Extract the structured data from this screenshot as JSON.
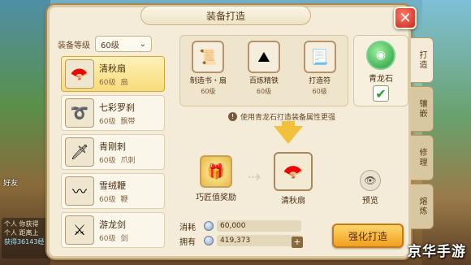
{
  "window": {
    "title": "装备打造",
    "close_label": "✕"
  },
  "filter": {
    "label": "装备等级",
    "selected": "60级"
  },
  "equipment_list": [
    {
      "name": "清秋扇",
      "level": "60级",
      "type": "扇",
      "icon": "fan-icon",
      "selected": true
    },
    {
      "name": "七彩罗刹",
      "level": "60级",
      "type": "飘带",
      "icon": "ribbon-icon",
      "selected": false
    },
    {
      "name": "青刚刺",
      "level": "60级",
      "type": "爪刺",
      "icon": "claw-icon",
      "selected": false
    },
    {
      "name": "雪绒鞭",
      "level": "60级",
      "type": "鞭",
      "icon": "whip-icon",
      "selected": false
    },
    {
      "name": "游龙剑",
      "level": "60级",
      "type": "剑",
      "icon": "sword-icon",
      "selected": false
    }
  ],
  "materials": [
    {
      "name": "制造书・扇",
      "level": "60级",
      "icon": "blueprint-icon"
    },
    {
      "name": "百炼精铁",
      "level": "60级",
      "icon": "iron-ore-icon"
    },
    {
      "name": "打造符",
      "level": "60级",
      "icon": "talisman-icon"
    }
  ],
  "dragon_stone": {
    "name": "青龙石",
    "checked": true,
    "check_mark": "✔",
    "icon": "dragon-stone-icon"
  },
  "hint": {
    "icon_glyph": "!",
    "text": "使用青龙石打造装备属性更强"
  },
  "forge": {
    "reward_label": "巧匠值奖励",
    "target_label": "清秋扇",
    "preview_label": "预览",
    "link_arrow": "⇢"
  },
  "cost": {
    "consume_label": "消耗",
    "consume_value": "60,000",
    "own_label": "拥有",
    "own_value": "419,373",
    "plus": "+"
  },
  "forge_button": "强化打造",
  "tabs": [
    {
      "label": "打造",
      "active": true
    },
    {
      "label": "镶嵌",
      "active": false
    },
    {
      "label": "修理",
      "active": false
    },
    {
      "label": "熔炼",
      "active": false
    }
  ],
  "background": {
    "left_label": "好友",
    "chat_lines": [
      "个人 你获得",
      "个人 距离上",
      "获得36143经"
    ]
  },
  "watermark": "京华手游"
}
